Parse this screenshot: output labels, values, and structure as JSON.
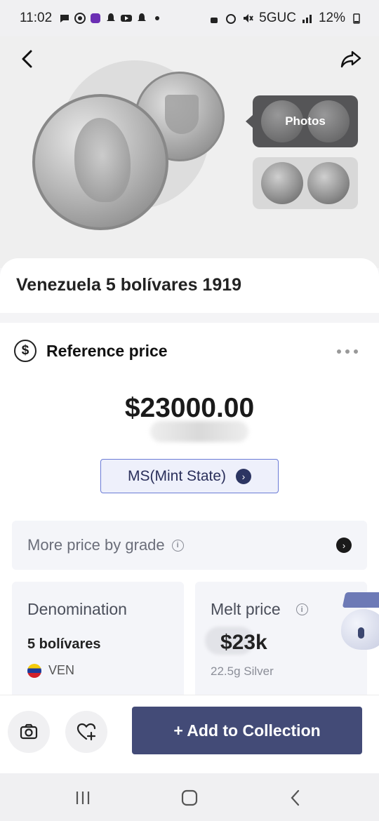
{
  "status_bar": {
    "time": "11:02",
    "network": "5GUC",
    "battery": "12%"
  },
  "hero": {
    "photos_label": "Photos"
  },
  "coin": {
    "title": "Venezuela 5 bolívares 1919"
  },
  "reference": {
    "title": "Reference price",
    "price": "$23000.00",
    "grade": "MS(Mint State)",
    "more_price_label": "More price by grade"
  },
  "denomination": {
    "label": "Denomination",
    "value": "5 bolívares",
    "country": "VEN"
  },
  "melt": {
    "label": "Melt price",
    "value": "$23k",
    "detail": "22.5g Silver"
  },
  "actions": {
    "add_to_collection": "+ Add to Collection"
  },
  "colors": {
    "primary": "#434b77",
    "grade_border": "#6a7bd6",
    "grade_bg": "#eef0fb"
  },
  "icons": [
    "back-arrow-icon",
    "share-icon",
    "dollar-icon",
    "more-dots-icon",
    "info-icon",
    "chevron-right-icon",
    "camera-icon",
    "heart-plus-icon",
    "nav-recent-icon",
    "nav-home-icon",
    "nav-back-icon"
  ]
}
